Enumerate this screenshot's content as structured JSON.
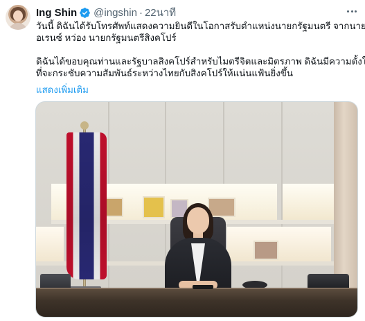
{
  "tweet": {
    "author": {
      "display_name": "Ing Shin",
      "handle": "@ingshin",
      "verified": true,
      "avatar_icon": "profile-photo"
    },
    "separator": "·",
    "timestamp": "22นาที",
    "more_icon": "more-horizontal-icon",
    "text_lines_p1": [
      "วันนี้ ดิฉันได้รับโทรศัพท์แสดงความยินดีในโอกาสรับตำแหน่งนายกรัฐมนตรี จากนายล",
      "อเรนซ์ หว่อง นายกรัฐมนตรีสิงคโปร์"
    ],
    "text_lines_p2": [
      "ดิฉันได้ขอบคุณท่านและรัฐบาลสิงคโปร์สำหรับไมตรีจิตและมิตรภาพ ดิฉันมีความตั้งใจ",
      "ที่จะกระชับความสัมพันธ์ระหว่างไทยกับสิงคโปร์ให้แน่นแฟ้นยิ่งขึ้น"
    ],
    "show_more": "แสดงเพิ่มเติม",
    "colors": {
      "link": "#1d9bf0",
      "verified_badge": "#1d9bf0",
      "text": "#0f1419",
      "muted": "#536471"
    }
  }
}
